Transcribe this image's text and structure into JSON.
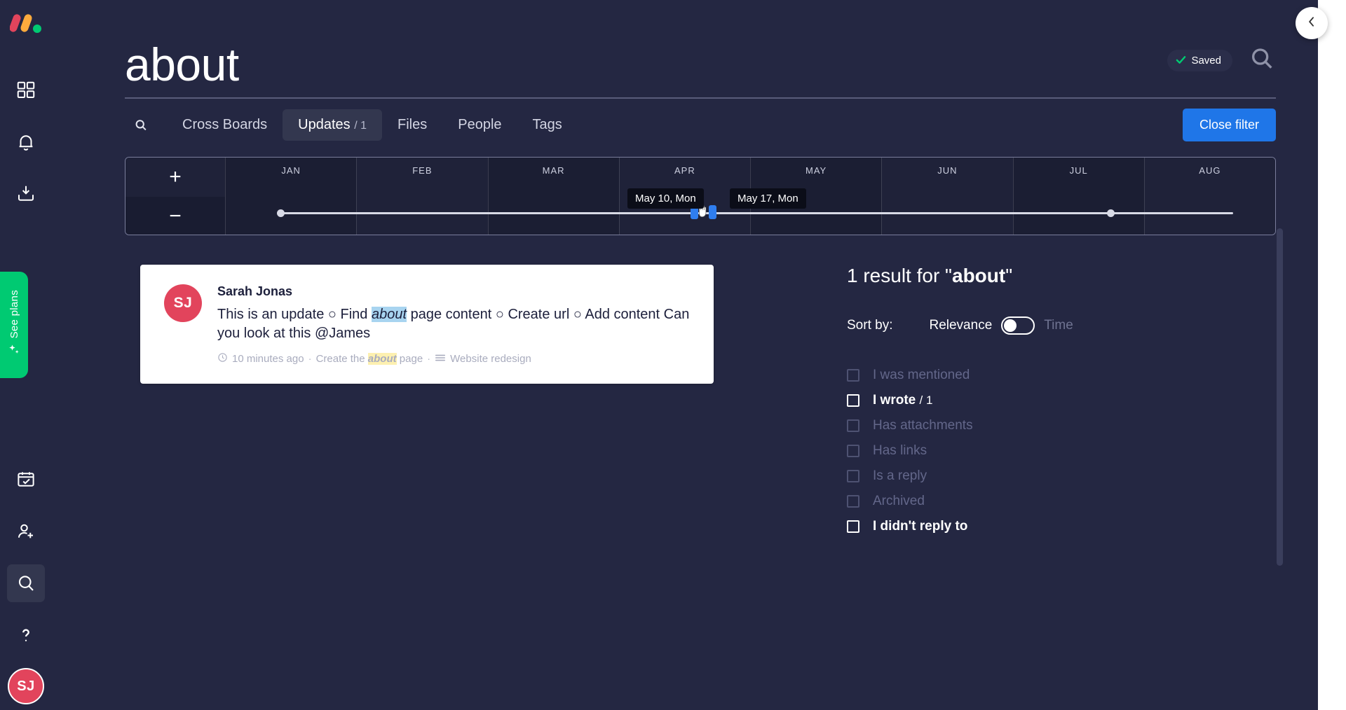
{
  "app": {
    "logo": "monday-logo",
    "background": "#242742"
  },
  "rail": {
    "icons": [
      {
        "name": "dashboard-icon",
        "label": "Dashboard"
      },
      {
        "name": "bell-icon",
        "label": "Notifications"
      },
      {
        "name": "inbox-icon",
        "label": "Inbox"
      }
    ],
    "see_plans": {
      "label": "See plans",
      "color": "#00ca72",
      "icon": "sparkle-icon"
    },
    "bottom_icons": [
      {
        "name": "calendar-check-icon",
        "label": "My week"
      },
      {
        "name": "invite-user-icon",
        "label": "Invite members"
      },
      {
        "name": "search-icon",
        "label": "Search",
        "active": true
      },
      {
        "name": "help-icon",
        "label": "Help"
      }
    ],
    "avatar": {
      "initials": "SJ",
      "color": "#e2445c"
    }
  },
  "header": {
    "title": "about",
    "saved_badge": {
      "label": "Saved",
      "icon": "check-icon",
      "color": "#00ca72"
    },
    "search_icon": "search-icon"
  },
  "tabs": {
    "search_icon": "search-icon",
    "items": [
      {
        "label": "Cross Boards",
        "count": "",
        "active": false
      },
      {
        "label": "Updates",
        "count": "/ 1",
        "active": true
      },
      {
        "label": "Files",
        "count": "",
        "active": false
      },
      {
        "label": "People",
        "count": "",
        "active": false
      },
      {
        "label": "Tags",
        "count": "",
        "active": false
      }
    ],
    "close_filter_label": "Close filter",
    "close_filter_color": "#1f76e8"
  },
  "timeline": {
    "zoom_in": "+",
    "zoom_out": "−",
    "months": [
      "JAN",
      "FEB",
      "MAR",
      "APR",
      "MAY",
      "JUN",
      "JUL",
      "AUG"
    ],
    "range_start_tooltip": "May 10, Mon",
    "range_end_tooltip": "May 17, Mon",
    "handle_color": "#2f7ef0"
  },
  "results": {
    "card": {
      "avatar_initials": "SJ",
      "author": "Sarah Jonas",
      "text_before": "This is an update ○ Find ",
      "highlight": "about",
      "text_after": " page content ○ Create url ○ Add content Can you look at this @James",
      "meta": {
        "clock_icon": "clock-icon",
        "time": "10 minutes ago",
        "item_prefix": "Create the ",
        "item_highlight": "about",
        "item_suffix": " page",
        "board_icon": "board-icon",
        "board": "Website redesign",
        "separator": "·"
      }
    }
  },
  "filter_panel": {
    "result_count_prefix": "1 result for \"",
    "result_count_term": "about",
    "result_count_suffix": "\"",
    "sort_label": "Sort by:",
    "sort_primary": "Relevance",
    "sort_secondary": "Time",
    "sort_selected": "Relevance",
    "filters": [
      {
        "label": "I was mentioned",
        "count": "",
        "enabled": false,
        "checked": false
      },
      {
        "label": "I wrote",
        "count": "/ 1",
        "enabled": true,
        "checked": false
      },
      {
        "label": "Has attachments",
        "count": "",
        "enabled": false,
        "checked": false
      },
      {
        "label": "Has links",
        "count": "",
        "enabled": false,
        "checked": false
      },
      {
        "label": "Is a reply",
        "count": "",
        "enabled": false,
        "checked": false
      },
      {
        "label": "Archived",
        "count": "",
        "enabled": false,
        "checked": false
      },
      {
        "label": "I didn't reply to",
        "count": "",
        "enabled": true,
        "checked": false
      }
    ]
  },
  "collapse_button": {
    "icon": "chevron-left-icon"
  }
}
